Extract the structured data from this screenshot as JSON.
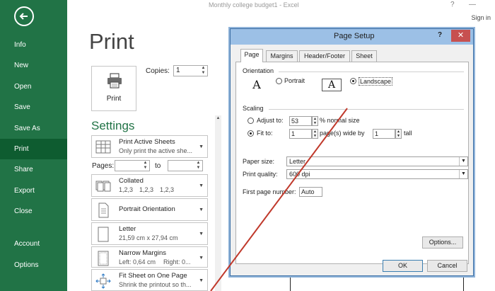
{
  "window": {
    "title": "Monthly college budget1 - Excel",
    "help": "?",
    "minimize": "—",
    "sign_in": "Sign in"
  },
  "sidebar": {
    "items": [
      {
        "label": "Info"
      },
      {
        "label": "New"
      },
      {
        "label": "Open"
      },
      {
        "label": "Save"
      },
      {
        "label": "Save As"
      },
      {
        "label": "Print",
        "active": true
      },
      {
        "label": "Share"
      },
      {
        "label": "Export"
      },
      {
        "label": "Close"
      },
      {
        "label": "Account"
      },
      {
        "label": "Options"
      }
    ]
  },
  "print": {
    "title": "Print",
    "button_label": "Print",
    "copies_label": "Copies:",
    "copies_value": "1",
    "settings_title": "Settings",
    "pages_label": "Pages:",
    "to_label": "to",
    "dropdowns": {
      "sheets": {
        "title": "Print Active Sheets",
        "subtitle": "Only print the active she..."
      },
      "collated": {
        "title": "Collated",
        "subtitle": [
          "1,2,3",
          "1,2,3",
          "1,2,3"
        ]
      },
      "orientation": {
        "title": "Portrait Orientation"
      },
      "paper": {
        "title": "Letter",
        "subtitle": "21,59 cm x 27,94 cm"
      },
      "margins": {
        "title": "Narrow Margins",
        "subtitle_left": "Left:  0,64 cm",
        "subtitle_right": "Right:  0..."
      },
      "fit": {
        "title": "Fit Sheet on One Page",
        "subtitle": "Shrink the printout so th..."
      }
    }
  },
  "dialog": {
    "title": "Page Setup",
    "help": "?",
    "close": "✕",
    "tabs": [
      {
        "label": "Page",
        "active": true
      },
      {
        "label": "Margins"
      },
      {
        "label": "Header/Footer"
      },
      {
        "label": "Sheet"
      }
    ],
    "orientation_label": "Orientation",
    "portrait_label": "Portrait",
    "landscape_label": "Landscape",
    "orientation_selected": "Landscape",
    "scaling_label": "Scaling",
    "adjust_to_label": "Adjust to:",
    "adjust_to_value": "53",
    "normal_size_label": "% normal size",
    "fit_to_label": "Fit to:",
    "fit_wide_value": "1",
    "pages_wide_label": "page(s) wide by",
    "fit_tall_value": "1",
    "tall_label": "tall",
    "scaling_selected": "Fit to",
    "paper_size_label": "Paper size:",
    "paper_size_value": "Letter",
    "print_quality_label": "Print quality:",
    "print_quality_value": "600 dpi",
    "first_page_label": "First page number:",
    "first_page_value": "Auto",
    "options_button": "Options...",
    "ok_button": "OK",
    "cancel_button": "Cancel"
  },
  "colors": {
    "excel_green": "#217346",
    "active_nav": "#0e5c30",
    "dialog_title_bg": "#9cc0e6",
    "close_button": "#c75050",
    "annotation_line": "#c0392b"
  },
  "icons": [
    "back-arrow-icon",
    "printer-icon",
    "sheets-grid-icon",
    "collated-pages-icon",
    "portrait-page-icon",
    "letter-page-icon",
    "margins-page-icon",
    "fit-arrows-icon"
  ]
}
